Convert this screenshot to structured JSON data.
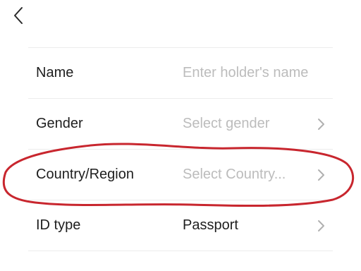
{
  "colors": {
    "label": "#1e1e1e",
    "placeholder": "#bcbcbc",
    "divider": "#ececec",
    "chevron": "#b0b0b0",
    "annotation": "#c8262e"
  },
  "nav": {
    "back_icon": "chevron-left-icon"
  },
  "form": {
    "name": {
      "label": "Name",
      "placeholder": "Enter holder's name"
    },
    "gender": {
      "label": "Gender",
      "placeholder": "Select gender",
      "icon": "chevron-right-icon"
    },
    "country": {
      "label": "Country/Region",
      "placeholder": "Select Country...",
      "icon": "chevron-right-icon"
    },
    "id_type": {
      "label": "ID type",
      "value": "Passport",
      "icon": "chevron-right-icon"
    }
  }
}
